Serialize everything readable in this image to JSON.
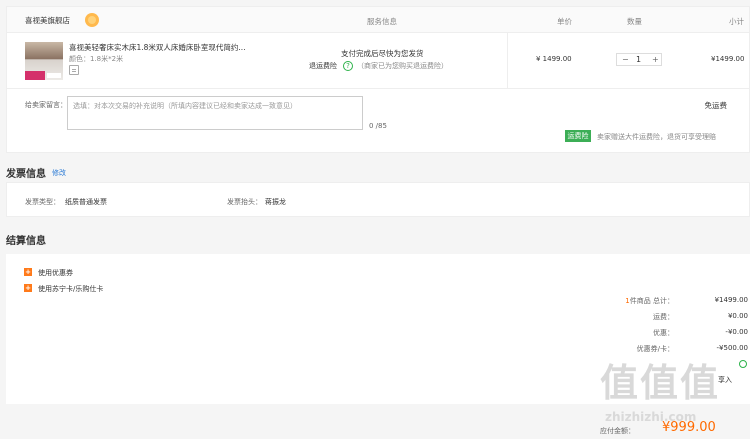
{
  "columns": {
    "store": "喜视美旗舰店",
    "service": "服务信息",
    "price": "单价",
    "qty": "数量",
    "subtotal": "小计"
  },
  "item": {
    "title": "喜视美轻奢床实木床1.8米双人床婚床卧室现代简约...",
    "spec": "颜色：1.8米*2米",
    "service_main": "支付完成后尽快为您发货",
    "service_ins": "退运费险",
    "service_note": "（商家已为您购买退运费险）",
    "price": "¥ 1499.00",
    "qty_minus": "−",
    "qty_value": "1",
    "qty_plus": "+",
    "subtotal": "¥1499.00"
  },
  "message": {
    "label": "给卖家留言：",
    "placeholder": "选填：对本次交易的补充说明（所填内容建议已经和卖家达成一致意见）",
    "count": "0 /85",
    "free_shipping": "免运费",
    "ins_badge": "运费险",
    "ins_text": "卖家赠送大件运费险，退货可享受理赔"
  },
  "invoice": {
    "title": "发票信息",
    "modify": "修改",
    "type_label": "发票类型：",
    "type_value": "纸质普通发票",
    "head_label": "发票抬头：",
    "head_value": "蒋振龙"
  },
  "settlement": {
    "title": "结算信息",
    "options": [
      "使用优惠券",
      "使用苏宁卡/乐购仕卡"
    ],
    "count_prefix": "1",
    "count_suffix": "件商品 总计：",
    "total": "¥1499.00",
    "shipping_label": "运费：",
    "shipping_value": "¥0.00",
    "discount_label": "优惠：",
    "discount_value": "-¥0.00",
    "coupon_label": "优惠券/卡：",
    "coupon_value": "-¥500.00",
    "partial_row": "享入",
    "pay_label": "应付金额：",
    "pay_amount": "¥999.00"
  },
  "watermark": {
    "glyphs": "值值值",
    "site": "zhizhizhi.com"
  },
  "colors": {
    "accent_orange": "#ff6a00",
    "green": "#3cae56",
    "link_blue": "#2a7ad5"
  }
}
